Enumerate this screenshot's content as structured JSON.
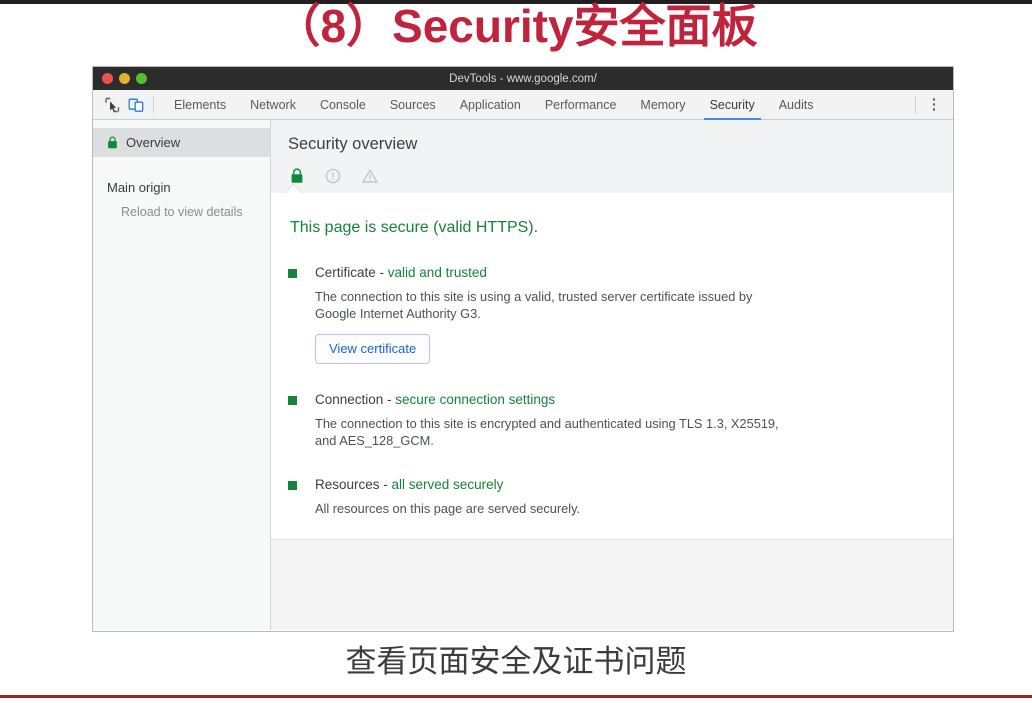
{
  "slide": {
    "title": "（8）Security安全面板",
    "caption": "查看页面安全及证书问题",
    "title_color": "#c0233c",
    "rule_color": "#a51c20"
  },
  "window": {
    "title": "DevTools - www.google.com/",
    "traffic_lights": [
      "close-red",
      "minimize-yellow",
      "maximize-green"
    ]
  },
  "toolbar": {
    "icons": [
      {
        "name": "inspect-element-icon",
        "state": "inactive"
      },
      {
        "name": "device-toolbar-icon",
        "state": "active"
      }
    ],
    "more_options": "more-options-icon"
  },
  "tabs": [
    {
      "label": "Elements",
      "active": false
    },
    {
      "label": "Network",
      "active": false
    },
    {
      "label": "Console",
      "active": false
    },
    {
      "label": "Sources",
      "active": false
    },
    {
      "label": "Application",
      "active": false
    },
    {
      "label": "Performance",
      "active": false
    },
    {
      "label": "Memory",
      "active": false
    },
    {
      "label": "Security",
      "active": true
    },
    {
      "label": "Audits",
      "active": false
    }
  ],
  "sidebar": {
    "overview_label": "Overview",
    "overview_icon": "green-lock-icon",
    "group_label": "Main origin",
    "group_note": "Reload to view details"
  },
  "overview": {
    "title": "Security overview",
    "summary_icons": [
      {
        "name": "secure-lock-icon",
        "state": "active",
        "color": "#0f8a3c"
      },
      {
        "name": "info-circle-icon",
        "state": "inactive",
        "color": "#c4c7c9"
      },
      {
        "name": "warning-triangle-icon",
        "state": "inactive",
        "color": "#c4c7c9"
      }
    ],
    "headline": "This page is secure (valid HTTPS).",
    "headline_color": "#178239",
    "sections": [
      {
        "title": "Certificate - ",
        "value": "valid and trusted",
        "description": "The connection to this site is using a valid, trusted server certificate issued by Google Internet Authority G3.",
        "button": "View certificate",
        "bullet_color": "#178239"
      },
      {
        "title": "Connection - ",
        "value": "secure connection settings",
        "description": "The connection to this site is encrypted and authenticated using TLS 1.3, X25519, and AES_128_GCM.",
        "button": null,
        "bullet_color": "#178239"
      },
      {
        "title": "Resources - ",
        "value": "all served securely",
        "description": "All resources on this page are served securely.",
        "button": null,
        "bullet_color": "#178239"
      }
    ]
  }
}
